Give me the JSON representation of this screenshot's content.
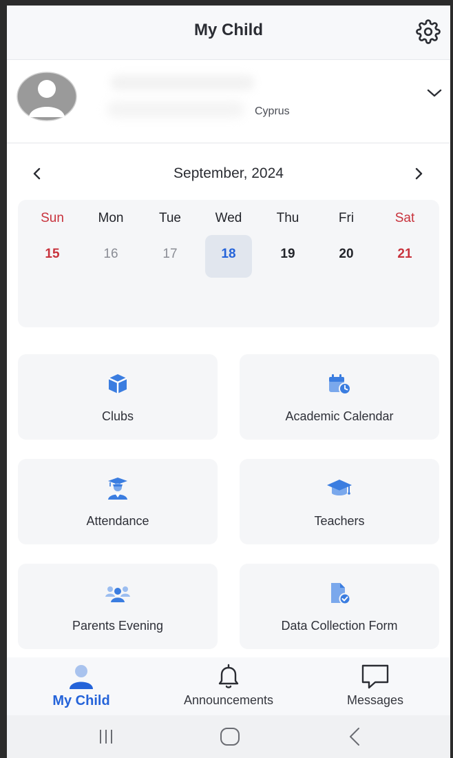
{
  "header": {
    "title": "My Child"
  },
  "profile": {
    "country": "Cyprus"
  },
  "calendar": {
    "month_label": "September, 2024",
    "weekdays": [
      "Sun",
      "Mon",
      "Tue",
      "Wed",
      "Thu",
      "Fri",
      "Sat"
    ],
    "days": [
      "15",
      "16",
      "17",
      "18",
      "19",
      "20",
      "21"
    ],
    "selected_day": "18"
  },
  "tiles": [
    {
      "label": "Clubs",
      "icon": "cube-icon"
    },
    {
      "label": "Academic Calendar",
      "icon": "calendar-clock-icon"
    },
    {
      "label": "Attendance",
      "icon": "graduate-icon"
    },
    {
      "label": "Teachers",
      "icon": "mortarboard-icon"
    },
    {
      "label": "Parents Evening",
      "icon": "group-icon"
    },
    {
      "label": "Data Collection Form",
      "icon": "document-check-icon"
    }
  ],
  "bottom_nav": [
    {
      "label": "My Child",
      "icon": "person-icon",
      "active": true
    },
    {
      "label": "Announcements",
      "icon": "bell-icon",
      "active": false
    },
    {
      "label": "Messages",
      "icon": "chat-icon",
      "active": false
    }
  ],
  "colors": {
    "accent": "#2463d9",
    "weekend": "#c8323c",
    "icon_blue": "#3b7de0"
  }
}
